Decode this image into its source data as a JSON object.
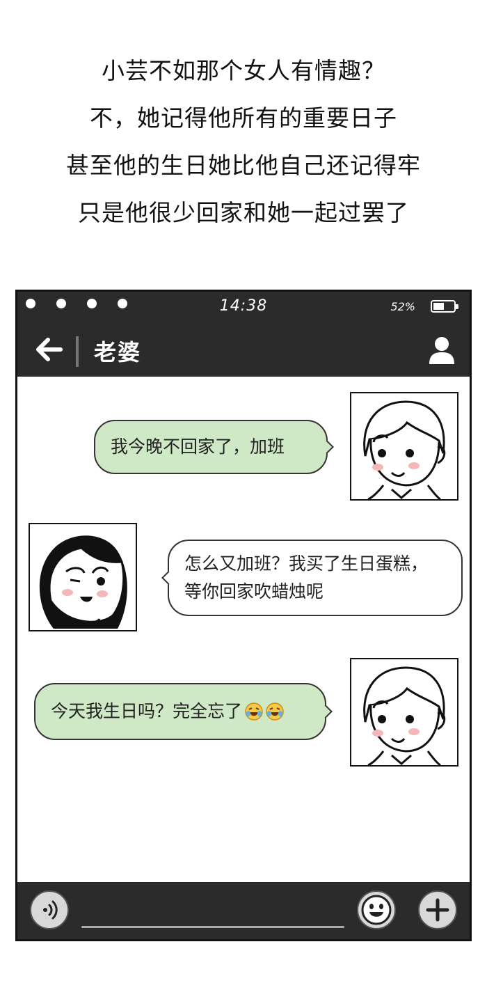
{
  "caption": {
    "lines": [
      "小芸不如那个女人有情趣？",
      "不，她记得他所有的重要日子",
      "甚至他的生日她比他自己还记得牢",
      "只是他很少回家和她一起过罢了"
    ]
  },
  "statusbar": {
    "time": "14:38",
    "battery_percent": "52%",
    "battery_level": 0.52
  },
  "navbar": {
    "title": "老婆",
    "back_icon": "arrow-left-icon",
    "profile_icon": "user-icon"
  },
  "messages": [
    {
      "from": "husband",
      "side": "right",
      "text": "我今晚不回家了，加班"
    },
    {
      "from": "wife",
      "side": "left",
      "lines": [
        "怎么又加班？我买了生日蛋糕，",
        "等你回家吹蜡烛呢"
      ]
    },
    {
      "from": "husband",
      "side": "right",
      "text": "今天我生日吗？完全忘了",
      "emojis": [
        "laughing-crying-emoji",
        "laughing-crying-emoji"
      ]
    }
  ],
  "inputbar": {
    "voice_icon": "voice-icon",
    "emoji_icon": "smiley-icon",
    "plus_icon": "plus-icon"
  },
  "colors": {
    "bar": "#2b2b2b",
    "green_bubble": "#cfe8c6"
  }
}
